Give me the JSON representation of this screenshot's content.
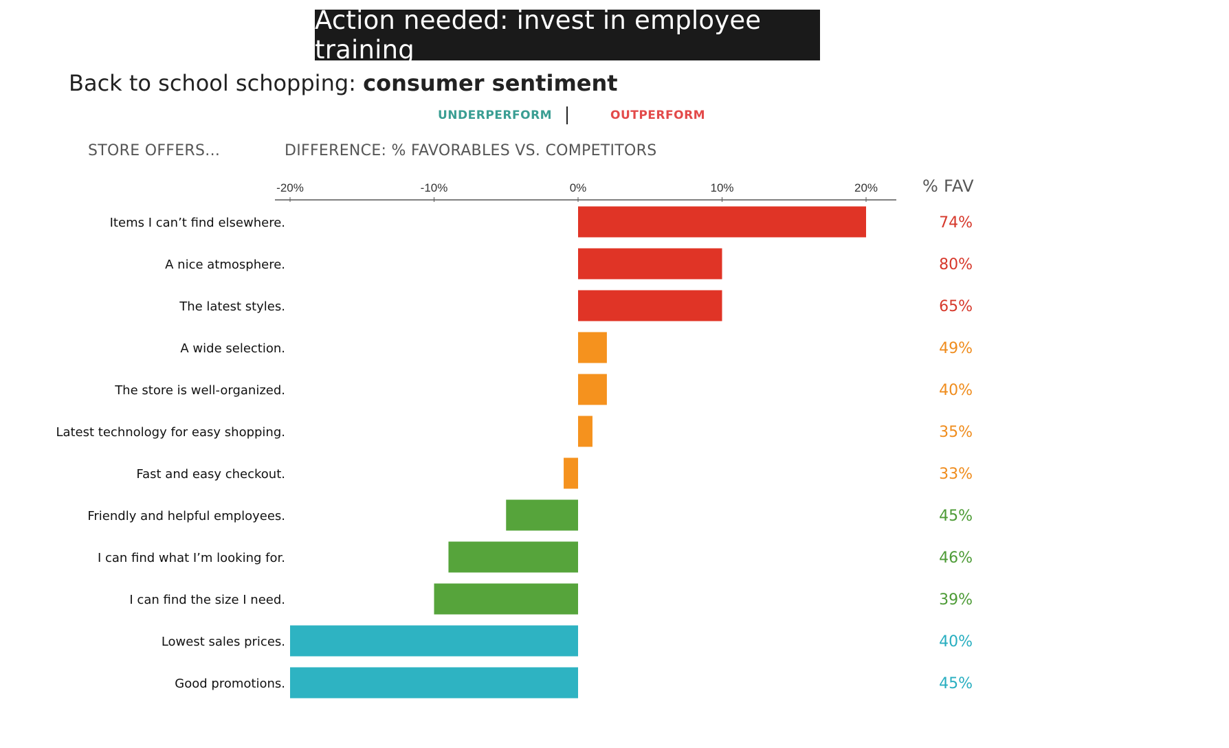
{
  "banner": "Action needed: invest in employee training",
  "subtitle": {
    "prefix": "Back to school schopping: ",
    "emphasis": "consumer sentiment"
  },
  "legend": {
    "underperform": {
      "label": "UNDERPERFORM",
      "color": "#3a9e93"
    },
    "outperform": {
      "label": "OUTPERFORM",
      "color": "#e34a4a"
    }
  },
  "headers": {
    "left": "STORE OFFERS...",
    "middle": "DIFFERENCE: % FAVORABLES VS. COMPETITORS",
    "right": "% FAV"
  },
  "chart_data": {
    "type": "bar",
    "orientation": "horizontal",
    "xlabel": "DIFFERENCE: % FAVORABLES VS. COMPETITORS",
    "xlim": [
      -20,
      22
    ],
    "ticks": [
      -20,
      -10,
      0,
      10,
      20
    ],
    "tick_labels": [
      "-20%",
      "-10%",
      "0%",
      "10%",
      "20%"
    ],
    "categories": [
      "Items I can’t find elsewhere.",
      "A nice atmosphere.",
      "The latest styles.",
      "A wide selection.",
      "The store is well-organized.",
      "Latest technology for easy shopping.",
      "Fast and easy checkout.",
      "Friendly and helpful employees.",
      "I can find what I’m looking for.",
      "I can find the size I need.",
      "Lowest sales prices.",
      "Good promotions."
    ],
    "values": [
      20,
      10,
      10,
      2,
      2,
      1,
      -1,
      -5,
      -9,
      -10,
      -20,
      -20
    ],
    "fav_labels": [
      "74%",
      "80%",
      "65%",
      "49%",
      "40%",
      "35%",
      "33%",
      "45%",
      "46%",
      "39%",
      "40%",
      "45%"
    ],
    "groups": [
      "red",
      "red",
      "red",
      "orange",
      "orange",
      "orange",
      "orange",
      "green",
      "green",
      "green",
      "teal",
      "teal"
    ],
    "colors": {
      "red": {
        "bar": "#e03426",
        "text": "#d6382b"
      },
      "orange": {
        "bar": "#f5921e",
        "text": "#ef8c1d"
      },
      "green": {
        "bar": "#56a43b",
        "text": "#4d9b36"
      },
      "teal": {
        "bar": "#2eb3c2",
        "text": "#28aec0"
      }
    }
  }
}
